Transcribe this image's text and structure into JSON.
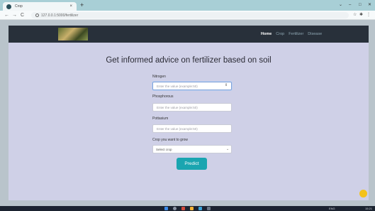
{
  "browser": {
    "tab_title": "Crop",
    "tab_close": "×",
    "new_tab": "+",
    "url": "127.0.0.1:5000/fertilizer",
    "window_controls": {
      "chevron": "⌄",
      "minimize": "–",
      "maximize": "□",
      "close": "✕"
    },
    "nav": {
      "back": "←",
      "forward": "→",
      "reload": "C"
    }
  },
  "site": {
    "nav_links": [
      "Home",
      "Crop",
      "Fertilizer",
      "Disease"
    ],
    "active_link": "Home"
  },
  "form": {
    "heading": "Get informed advice on fertilizer based on soil",
    "nitrogen_label": "Nitrogen",
    "nitrogen_placeholder": "Enter the value (example:50)",
    "phosphorous_label": "Phosphorous",
    "phosphorous_placeholder": "Enter the value (example:50)",
    "potassium_label": "Pottasium",
    "potassium_placeholder": "Enter the value (example:50)",
    "crop_label": "Crop you want to grow",
    "crop_select_value": "Select crop",
    "predict_label": "Predict"
  },
  "taskbar": {
    "lang": "ENG",
    "time": "15:21"
  },
  "colors": {
    "navbar": "#28303a",
    "main_bg": "#cfd0e7",
    "predict": "#1aa5b0",
    "chat_bubble": "#f4c21a"
  },
  "icons": [
    "favicon-icon",
    "info-icon",
    "back-icon",
    "forward-icon",
    "reload-icon",
    "chevron-down-icon",
    "chat-icon",
    "windows-icon",
    "search-icon"
  ]
}
